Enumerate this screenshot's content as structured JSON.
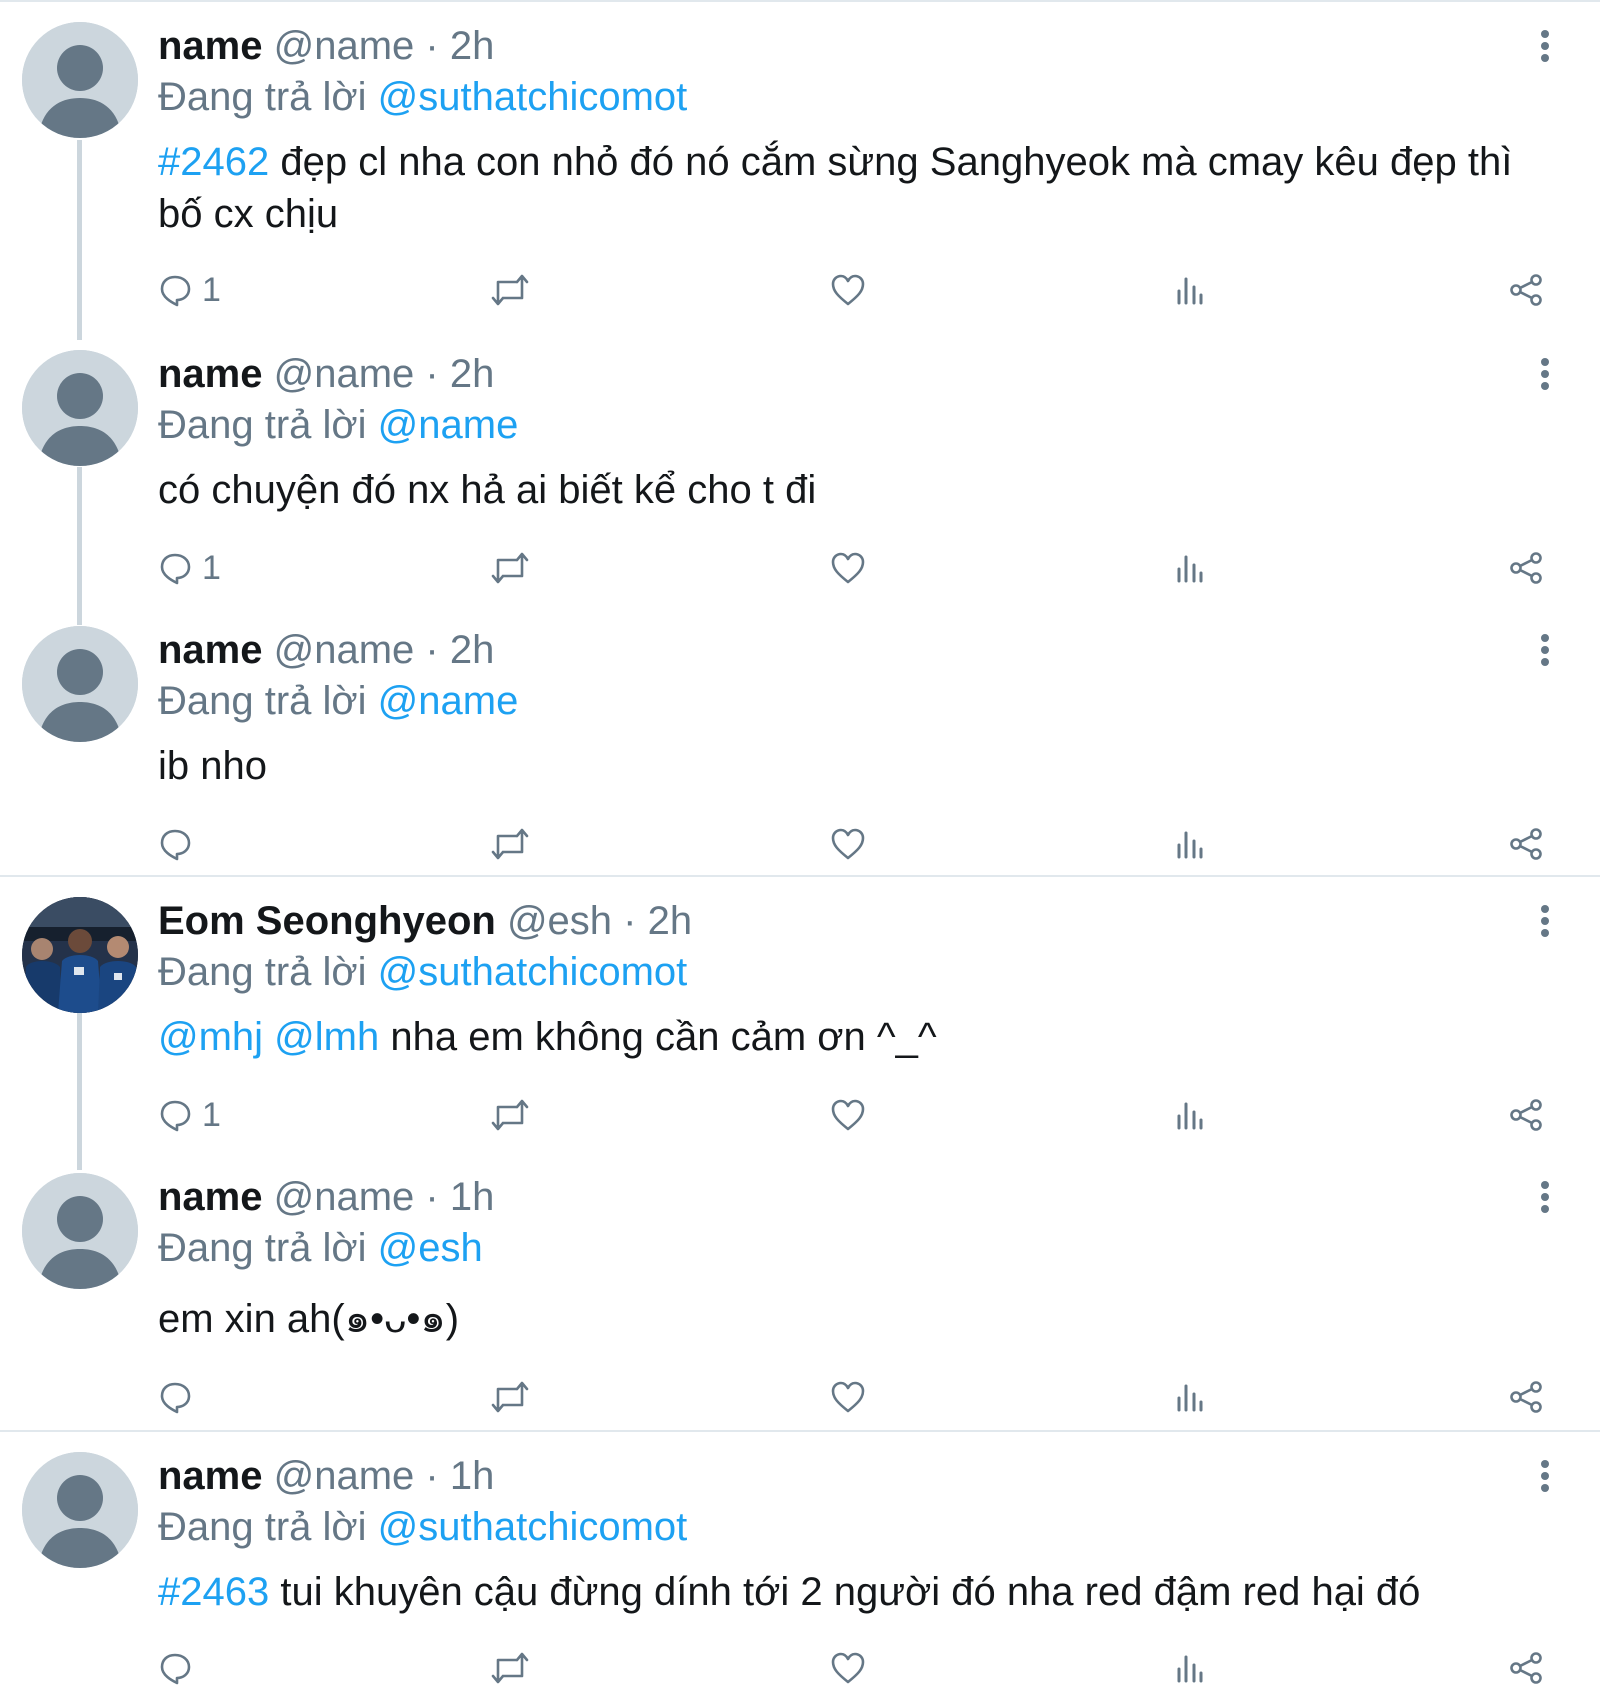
{
  "tweets": [
    {
      "name": "name",
      "handle": "@name",
      "sep": " · ",
      "time": "2h",
      "reply_label": "Đang trả lời ",
      "reply_to": "@suthatchicomot",
      "text_link": "#2462",
      "text": " đẹp cl nha con nhỏ đó nó cắm sừng Sanghyeok mà cmay kêu đẹp thì bố cx chịu",
      "reply_count": "1",
      "avatar": "default-avatar"
    },
    {
      "name": "name",
      "handle": "@name",
      "sep": " · ",
      "time": "2h",
      "reply_label": "Đang trả lời ",
      "reply_to": "@name",
      "text_link": "",
      "text": "có chuyện đó nx hả ai biết kể cho t đi",
      "reply_count": "1",
      "avatar": "default-avatar"
    },
    {
      "name": "name",
      "handle": "@name",
      "sep": " · ",
      "time": "2h",
      "reply_label": "Đang trả lời ",
      "reply_to": "@name",
      "text_link": "",
      "text": "ib nho",
      "reply_count": "",
      "avatar": "default-avatar"
    },
    {
      "name": "Eom Seonghyeon",
      "handle": "@esh",
      "sep": " · ",
      "time": "2h",
      "reply_label": "Đang trả lời ",
      "reply_to": "@suthatchicomot",
      "text_link": "@mhj @lmh",
      "text": " nha em không cần cảm ơn ^_^",
      "reply_count": "1",
      "avatar": "photo-avatar"
    },
    {
      "name": "name",
      "handle": "@name",
      "sep": " · ",
      "time": "1h",
      "reply_label": "Đang trả lời ",
      "reply_to": "@esh",
      "text_link": "",
      "text": "em xin ah(๑•ᴗ•๑)",
      "reply_count": "",
      "avatar": "default-avatar"
    },
    {
      "name": "name",
      "handle": "@name",
      "sep": " · ",
      "time": "1h",
      "reply_label": "Đang trả lời ",
      "reply_to": "@suthatchicomot",
      "text_link": "#2463",
      "text": " tui khuyên cậu đừng dính tới 2 người đó nha red đậm red hại đó",
      "reply_count": "",
      "avatar": "default-avatar"
    }
  ],
  "icons": {
    "reply": "reply-icon",
    "retweet": "retweet-icon",
    "like": "heart-icon",
    "analytics": "analytics-icon",
    "share": "share-icon",
    "more": "more-vertical-icon"
  },
  "colors": {
    "link": "#1da1f2",
    "muted": "#657786",
    "thread_line": "#ccd6dd",
    "divider": "#e1e8ed"
  }
}
